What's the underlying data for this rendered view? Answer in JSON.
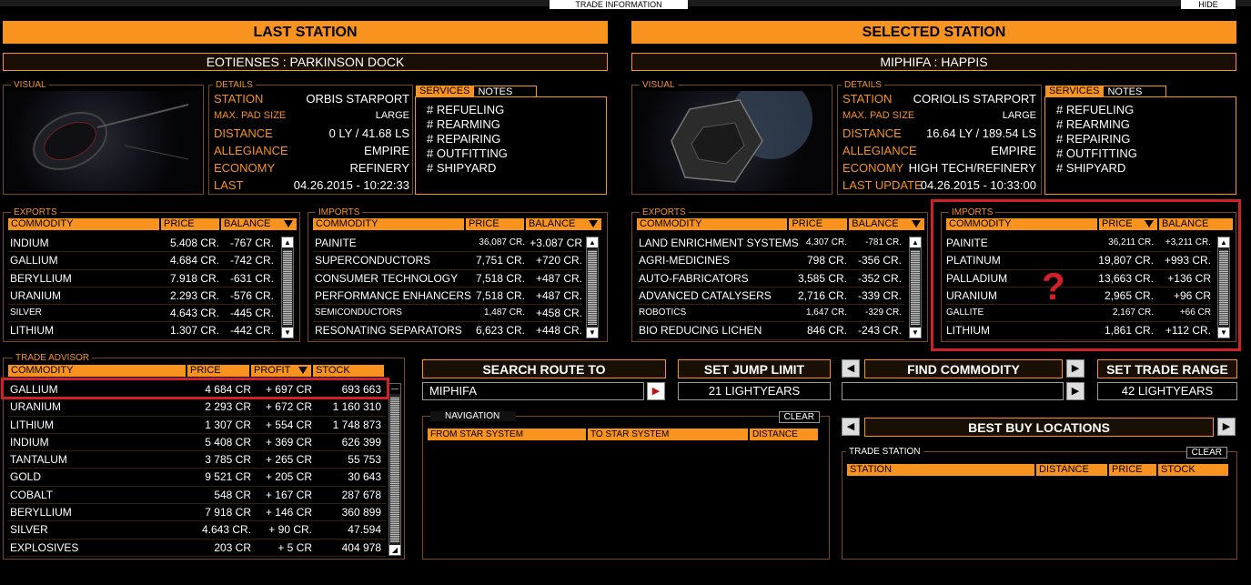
{
  "top": {
    "trade_info": "TRADE INFORMATION",
    "hide": "HIDE"
  },
  "last": {
    "header": "LAST STATION",
    "name": "EOTIENSES : PARKINSON DOCK",
    "visual_title": "VISUAL",
    "details_title": "DETAILS",
    "details": [
      {
        "label": "STATION",
        "value": "ORBIS STARPORT"
      },
      {
        "label": "MAX. PAD SIZE",
        "value": "LARGE"
      },
      {
        "label": "DISTANCE",
        "value": "0 LY / 41.68 LS"
      },
      {
        "label": "ALLEGIANCE",
        "value": "EMPIRE"
      },
      {
        "label": "ECONOMY",
        "value": "REFINERY"
      },
      {
        "label": "LAST",
        "value": "04.26.2015 - 10:22:33"
      }
    ],
    "tabs": {
      "services": "SERVICES",
      "notes": "NOTES"
    },
    "services": [
      "# REFUELING",
      "# REARMING",
      "# REPAIRING",
      "# OUTFITTING",
      "# SHIPYARD"
    ],
    "exports": {
      "title": "EXPORTS",
      "headers": [
        "COMMODITY",
        "PRICE",
        "BALANCE"
      ],
      "rows": [
        [
          "INDIUM",
          "5.408 CR.",
          "-767 CR."
        ],
        [
          "GALLIUM",
          "4.684 CR.",
          "-742 CR."
        ],
        [
          "BERYLLIUM",
          "7.918 CR.",
          "-631 CR."
        ],
        [
          "URANIUM",
          "2.293 CR.",
          "-576 CR."
        ],
        [
          "SILVER",
          "4.643 CR.",
          "-445 CR."
        ],
        [
          "LITHIUM",
          "1.307 CR.",
          "-442 CR."
        ]
      ]
    },
    "imports": {
      "title": "IMPORTS",
      "headers": [
        "COMMODITY",
        "PRICE",
        "BALANCE"
      ],
      "rows": [
        [
          "PAINITE",
          "36,087 CR.",
          "+3.087 CR"
        ],
        [
          "SUPERCONDUCTORS",
          "7,751 CR.",
          "+720 CR."
        ],
        [
          "CONSUMER TECHNOLOGY",
          "7,518 CR.",
          "+487 CR."
        ],
        [
          "PERFORMANCE ENHANCERS",
          "7,518 CR.",
          "+487 CR."
        ],
        [
          "SEMICONDUCTORS",
          "1,487 CR.",
          "+458 CR."
        ],
        [
          "RESONATING SEPARATORS",
          "6,623 CR.",
          "+448 CR."
        ]
      ]
    }
  },
  "selected": {
    "header": "SELECTED STATION",
    "name": "MIPHIFA : HAPPIS",
    "visual_title": "VISUAL",
    "details_title": "DETAILS",
    "details": [
      {
        "label": "STATION",
        "value": "CORIOLIS STARPORT"
      },
      {
        "label": "MAX. PAD SIZE",
        "value": "LARGE"
      },
      {
        "label": "DISTANCE",
        "value": "16.64 LY / 189.54 LS"
      },
      {
        "label": "ALLEGIANCE",
        "value": "EMPIRE"
      },
      {
        "label": "ECONOMY",
        "value": "HIGH TECH/REFINERY"
      },
      {
        "label": "LAST UPDATE",
        "value": "04.26.2015 - 10:33:00"
      }
    ],
    "tabs": {
      "services": "SERVICES",
      "notes": "NOTES"
    },
    "services": [
      "# REFUELING",
      "# REARMING",
      "# REPAIRING",
      "# OUTFITTING",
      "# SHIPYARD"
    ],
    "exports": {
      "title": "EXPORTS",
      "headers": [
        "COMMODITY",
        "PRICE",
        "BALANCE"
      ],
      "rows": [
        [
          "LAND ENRICHMENT SYSTEMS",
          "4,307 CR.",
          "-781 CR."
        ],
        [
          "AGRI-MEDICINES",
          "798 CR.",
          "-356 CR."
        ],
        [
          "AUTO-FABRICATORS",
          "3,585 CR.",
          "-352 CR."
        ],
        [
          "ADVANCED CATALYSERS",
          "2,716 CR.",
          "-339 CR."
        ],
        [
          "ROBOTICS",
          "1,647 CR.",
          "-329 CR."
        ],
        [
          "BIO REDUCING LICHEN",
          "846 CR.",
          "-243 CR."
        ]
      ]
    },
    "imports": {
      "title": "IMPORTS",
      "headers": [
        "COMMODITY",
        "PRICE",
        "BALANCE"
      ],
      "rows": [
        [
          "PAINITE",
          "36,211 CR.",
          "+3,211 CR."
        ],
        [
          "PLATINUM",
          "19,807 CR.",
          "+993 CR."
        ],
        [
          "PALLADIUM",
          "13,663 CR.",
          "+136 CR"
        ],
        [
          "URANIUM",
          "2,965 CR.",
          "+96 CR"
        ],
        [
          "GALLITE",
          "2,167 CR.",
          "+66 CR"
        ],
        [
          "LITHIUM",
          "1,861 CR.",
          "+112 CR."
        ]
      ]
    },
    "question_mark": "?"
  },
  "advisor": {
    "title": "TRADE ADVISOR",
    "headers": [
      "COMMODITY",
      "PRICE",
      "PROFIT",
      "STOCK"
    ],
    "rows": [
      [
        "GALLIUM",
        "4 684 CR",
        "+ 697 CR",
        "693 663"
      ],
      [
        "URANIUM",
        "2 293 CR",
        "+ 672 CR",
        "1 160 310"
      ],
      [
        "LITHIUM",
        "1 307 CR",
        "+ 554 CR",
        "1 748 873"
      ],
      [
        "INDIUM",
        "5 408 CR",
        "+ 369 CR",
        "626 399"
      ],
      [
        "TANTALUM",
        "3 785 CR",
        "+ 265 CR",
        "55 753"
      ],
      [
        "GOLD",
        "9 521 CR",
        "+ 205 CR",
        "30 643"
      ],
      [
        "COBALT",
        "548 CR",
        "+ 167 CR",
        "287 678"
      ],
      [
        "BERYLLIUM",
        "7 918 CR",
        "+ 146 CR",
        "360 899"
      ],
      [
        "SILVER",
        "4.643 CR.",
        "+ 90 CR.",
        "47.594"
      ],
      [
        "EXPLOSIVES",
        "203 CR",
        "+ 5 CR",
        "404 978"
      ]
    ]
  },
  "route": {
    "search_label": "SEARCH ROUTE TO",
    "search_value": "MIPHIFA",
    "jump_label": "SET JUMP LIMIT",
    "jump_value": "21 LIGHTYEARS",
    "nav_title": "NAVIGATION",
    "clear": "CLEAR",
    "nav_headers": [
      "FROM STAR SYSTEM",
      "TO STAR SYSTEM",
      "DISTANCE"
    ]
  },
  "commodity": {
    "find_label": "FIND COMMODITY",
    "find_value": "",
    "range_label": "SET TRADE RANGE",
    "range_value": "42 LIGHTYEARS",
    "best_buy": "BEST BUY LOCATIONS",
    "station_title": "TRADE STATION",
    "clear": "CLEAR",
    "headers": [
      "STATION",
      "DISTANCE",
      "PRICE",
      "STOCK"
    ]
  },
  "colors": {
    "accent": "#f7931e",
    "highlight": "#d0202a"
  }
}
